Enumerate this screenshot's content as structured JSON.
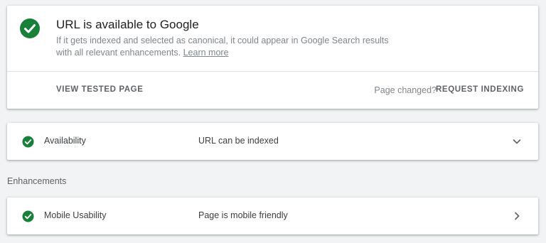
{
  "status": {
    "icon": "check-circle-icon",
    "title": "URL is available to Google",
    "description": "If it gets indexed and selected as canonical, it could appear in Google Search results with all relevant enhancements.",
    "learn_more": "Learn more",
    "color_success": "#188038"
  },
  "actions": {
    "view_tested_page": "VIEW TESTED PAGE",
    "page_changed": "Page changed?",
    "request_indexing": "REQUEST INDEXING"
  },
  "availability": {
    "icon": "check-circle-icon",
    "label": "Availability",
    "value": "URL can be indexed",
    "chevron": "chevron-down-icon"
  },
  "enhancements": {
    "heading": "Enhancements",
    "items": [
      {
        "icon": "check-circle-icon",
        "label": "Mobile Usability",
        "value": "Page is mobile friendly",
        "chevron": "chevron-right-icon"
      }
    ]
  }
}
